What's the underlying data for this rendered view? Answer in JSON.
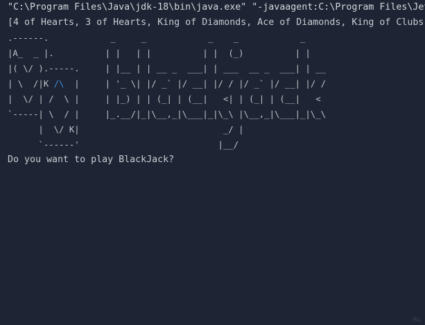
{
  "console": {
    "command_line": "\"C:\\Program Files\\Java\\jdk-18\\bin\\java.exe\" \"-javaagent:C:\\Program Files\\JetBrains",
    "hand_output": "[4 of Hearts, 3 of Hearts, King of Diamonds, Ace of Diamonds, King of Clubs]",
    "art": [
      ".------.            _     _            _    _            _",
      "|A_  _ |.          | |   | |          | |  (_)          | |",
      "|( \\/ ).-----.     | |__ | | __ _  ___| | ___  __ _  ___| | __",
      "| \\  /|K ",
      "|  \\/ | /  \\ |     | |_) | | (_| | (__|   <| | (_| | (__|   <",
      "`-----| \\  / |     |_.__/|_|\\__,_|\\___|_|\\_\\ |\\__,_|\\___|_|\\_\\",
      "      |  \\/ K|                            _/ |",
      "      `------'                           |__/"
    ],
    "art_accent": "/\\",
    "art_line4_rest": "  |     | '_ \\| |/ _` |/ __| |/ / |/ _` |/ __| |/ /",
    "prompt": "Do you want to play BlackJack?",
    "corner_tag": "Ru"
  },
  "colors": {
    "background": "#1e2433",
    "text": "#c8ccd4",
    "accent": "#3d8fe0"
  }
}
